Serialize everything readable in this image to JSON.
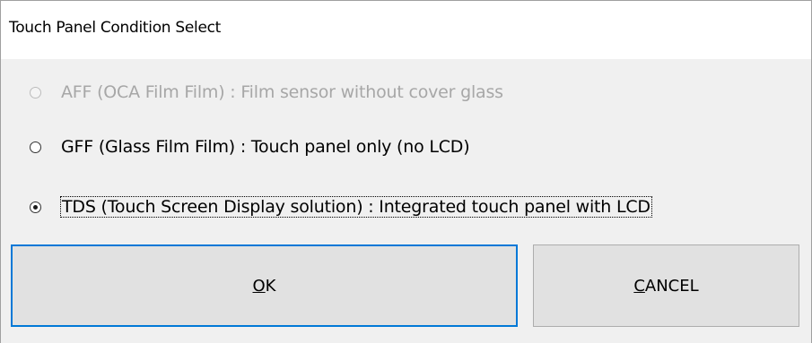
{
  "dialog": {
    "title": "Touch Panel Condition Select"
  },
  "options": [
    {
      "label": "AFF (OCA Film Film) : Film sensor without cover glass",
      "selected": false,
      "enabled": false
    },
    {
      "label": "GFF (Glass Film Film) : Touch panel only (no LCD)",
      "selected": false,
      "enabled": true
    },
    {
      "label": "TDS (Touch Screen Display solution) : Integrated touch panel with LCD",
      "selected": true,
      "enabled": true
    }
  ],
  "buttons": {
    "ok": {
      "mnemonic": "O",
      "rest": "K"
    },
    "cancel": {
      "mnemonic": "C",
      "rest": "ANCEL"
    }
  },
  "colors": {
    "dialog_background": "#f0f0f0",
    "button_background": "#e1e1e1",
    "default_button_border": "#0078d7",
    "disabled_text": "#a7a7a7"
  }
}
